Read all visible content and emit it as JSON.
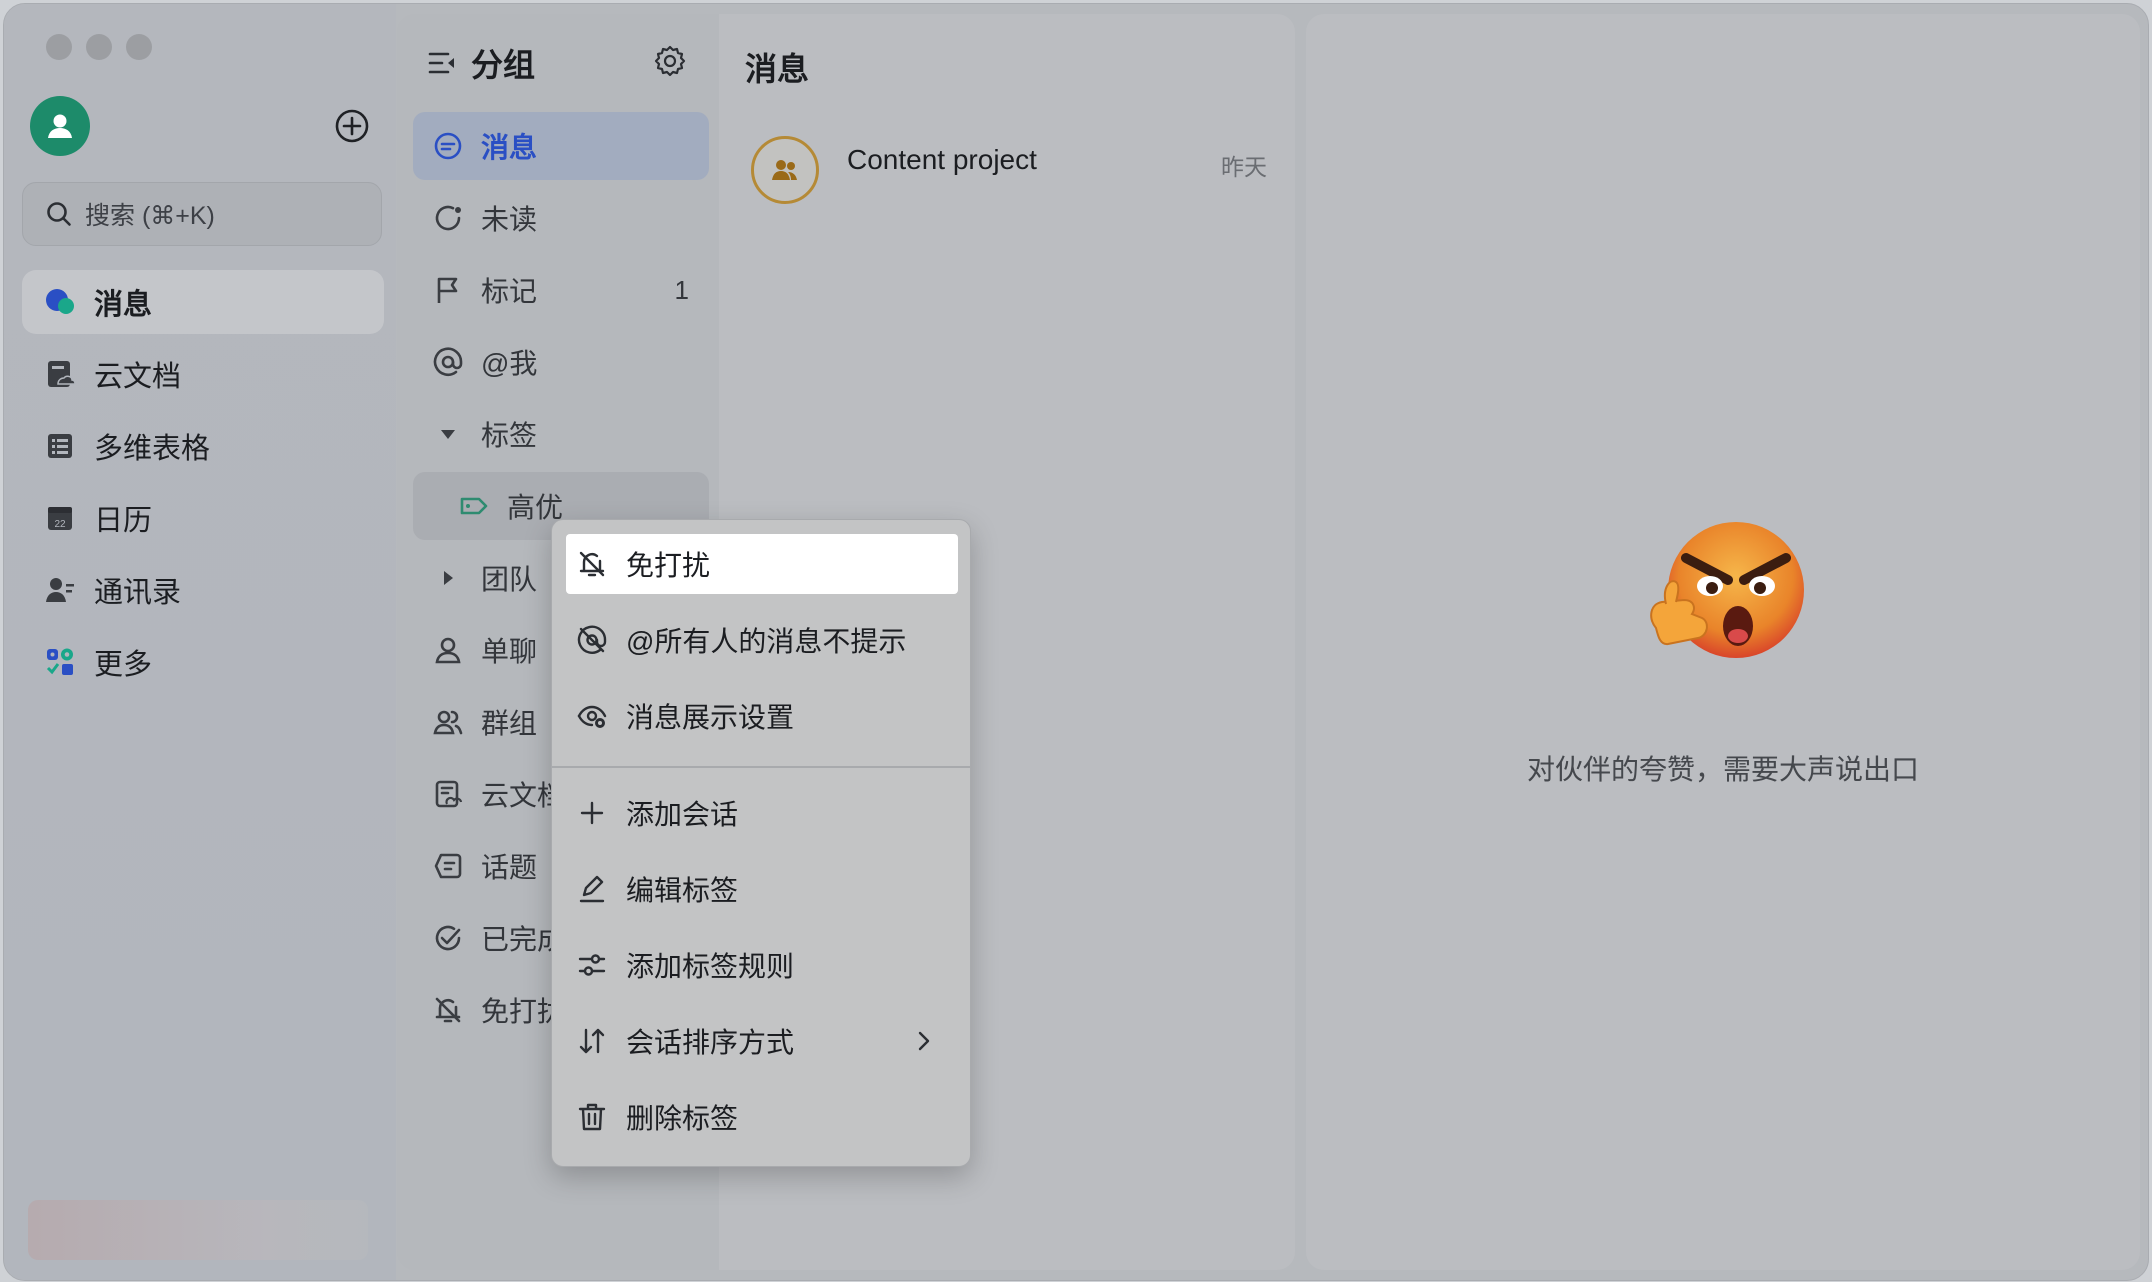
{
  "sidebar": {
    "search_placeholder": "搜索 (⌘+K)",
    "items": [
      {
        "label": "消息",
        "icon": "chat-bubbles-icon",
        "active": true
      },
      {
        "label": "云文档",
        "icon": "cloud-doc-icon"
      },
      {
        "label": "多维表格",
        "icon": "base-table-icon"
      },
      {
        "label": "日历",
        "icon": "calendar-icon",
        "day": "22"
      },
      {
        "label": "通讯录",
        "icon": "contacts-icon"
      },
      {
        "label": "更多",
        "icon": "more-apps-icon"
      }
    ]
  },
  "groups": {
    "title": "分组",
    "items": [
      {
        "label": "消息",
        "icon": "message-icon",
        "active": true
      },
      {
        "label": "未读",
        "icon": "unread-icon"
      },
      {
        "label": "标记",
        "icon": "flag-icon",
        "count": "1"
      },
      {
        "label": "@我",
        "icon": "at-icon"
      },
      {
        "label": "标签",
        "icon": "caret-down-icon"
      },
      {
        "label": "高优",
        "icon": "tag-icon",
        "sub": true
      },
      {
        "label": "团队",
        "icon": "caret-right-icon"
      },
      {
        "label": "单聊",
        "icon": "person-icon"
      },
      {
        "label": "群组",
        "icon": "group-icon"
      },
      {
        "label": "云文档",
        "icon": "doc-icon"
      },
      {
        "label": "话题",
        "icon": "topic-icon"
      },
      {
        "label": "已完成",
        "icon": "done-icon"
      },
      {
        "label": "免打扰",
        "icon": "bell-off-icon"
      }
    ]
  },
  "messages": {
    "title": "消息",
    "chats": [
      {
        "name": "Content project",
        "time": "昨天"
      }
    ]
  },
  "detail": {
    "tagline": "对伙伴的夸赞，需要大声说出口"
  },
  "context_menu": {
    "items": [
      {
        "label": "免打扰",
        "icon": "bell-off-icon",
        "highlighted": true
      },
      {
        "label": "@所有人的消息不提示",
        "icon": "at-mute-icon"
      },
      {
        "label": "消息展示设置",
        "icon": "display-settings-icon"
      },
      {
        "label": "添加会话",
        "icon": "plus-icon"
      },
      {
        "label": "编辑标签",
        "icon": "edit-icon"
      },
      {
        "label": "添加标签规则",
        "icon": "rules-icon"
      },
      {
        "label": "会话排序方式",
        "icon": "sort-icon",
        "submenu": true
      },
      {
        "label": "删除标签",
        "icon": "trash-icon"
      }
    ]
  },
  "colors": {
    "accent_blue": "#2a4fc4",
    "avatar_green": "#1d8b6a",
    "tag_green": "#2e8b70"
  }
}
